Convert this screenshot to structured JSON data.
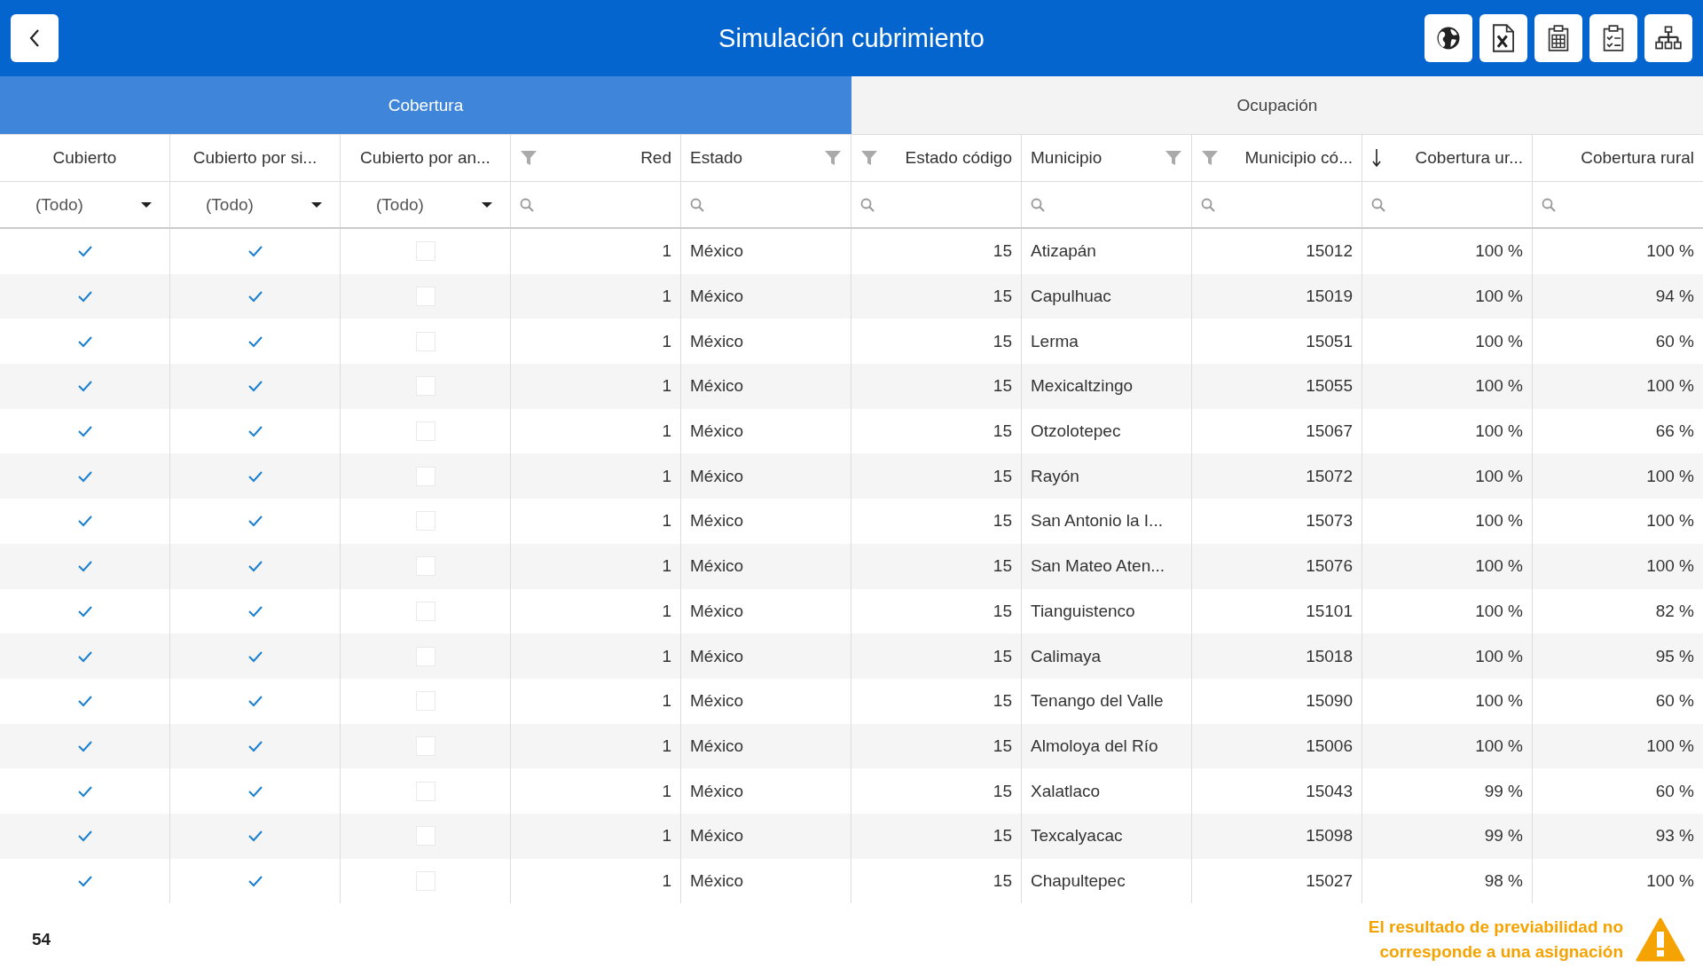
{
  "window": {
    "title": "Simulación cubrimiento"
  },
  "toolbar": [
    {
      "kind": "globe"
    },
    {
      "kind": "excel"
    },
    {
      "kind": "calendar"
    },
    {
      "kind": "checklist"
    },
    {
      "kind": "hierarchy"
    }
  ],
  "tabs": [
    {
      "label": "Cobertura",
      "selected": true
    },
    {
      "label": "Ocupación",
      "selected": false
    }
  ],
  "table": {
    "columns": [
      {
        "label": "Cubierto",
        "kind": "check",
        "filterable": false,
        "sorted_descending": false,
        "filter": "(Todo)"
      },
      {
        "label": "Cubierto por si...",
        "kind": "check",
        "filterable": false,
        "sorted_descending": false,
        "filter": "(Todo)"
      },
      {
        "label": "Cubierto por an...",
        "kind": "check",
        "filterable": false,
        "sorted_descending": false,
        "filter": "(Todo)"
      },
      {
        "label": "Red",
        "kind": "number",
        "filterable": true,
        "sorted_descending": false
      },
      {
        "label": "Estado",
        "kind": "text",
        "filterable": true,
        "sorted_descending": false
      },
      {
        "label": "Estado código",
        "kind": "number",
        "filterable": true,
        "sorted_descending": false
      },
      {
        "label": "Municipio",
        "kind": "text",
        "filterable": true,
        "sorted_descending": false
      },
      {
        "label": "Municipio có...",
        "kind": "number",
        "filterable": true,
        "sorted_descending": false
      },
      {
        "label": "Cobertura ur...",
        "kind": "number",
        "filterable": false,
        "sorted_descending": true
      },
      {
        "label": "Cobertura rural",
        "kind": "number",
        "filterable": false,
        "sorted_descending": false
      }
    ],
    "rows": [
      {
        "cells": [
          true,
          true,
          false,
          "1",
          "México",
          "15",
          "Atizapán",
          "15012",
          "100 %",
          "100 %"
        ]
      },
      {
        "cells": [
          true,
          true,
          false,
          "1",
          "México",
          "15",
          "Capulhuac",
          "15019",
          "100 %",
          "94 %"
        ]
      },
      {
        "cells": [
          true,
          true,
          false,
          "1",
          "México",
          "15",
          "Lerma",
          "15051",
          "100 %",
          "60 %"
        ]
      },
      {
        "cells": [
          true,
          true,
          false,
          "1",
          "México",
          "15",
          "Mexicaltzingo",
          "15055",
          "100 %",
          "100 %"
        ]
      },
      {
        "cells": [
          true,
          true,
          false,
          "1",
          "México",
          "15",
          "Otzolotepec",
          "15067",
          "100 %",
          "66 %"
        ]
      },
      {
        "cells": [
          true,
          true,
          false,
          "1",
          "México",
          "15",
          "Rayón",
          "15072",
          "100 %",
          "100 %"
        ]
      },
      {
        "cells": [
          true,
          true,
          false,
          "1",
          "México",
          "15",
          "San Antonio la I...",
          "15073",
          "100 %",
          "100 %"
        ]
      },
      {
        "cells": [
          true,
          true,
          false,
          "1",
          "México",
          "15",
          "San Mateo Aten...",
          "15076",
          "100 %",
          "100 %"
        ]
      },
      {
        "cells": [
          true,
          true,
          false,
          "1",
          "México",
          "15",
          "Tianguistenco",
          "15101",
          "100 %",
          "82 %"
        ]
      },
      {
        "cells": [
          true,
          true,
          false,
          "1",
          "México",
          "15",
          "Calimaya",
          "15018",
          "100 %",
          "95 %"
        ]
      },
      {
        "cells": [
          true,
          true,
          false,
          "1",
          "México",
          "15",
          "Tenango del Valle",
          "15090",
          "100 %",
          "60 %"
        ]
      },
      {
        "cells": [
          true,
          true,
          false,
          "1",
          "México",
          "15",
          "Almoloya del Río",
          "15006",
          "100 %",
          "100 %"
        ]
      },
      {
        "cells": [
          true,
          true,
          false,
          "1",
          "México",
          "15",
          "Xalatlaco",
          "15043",
          "99 %",
          "60 %"
        ]
      },
      {
        "cells": [
          true,
          true,
          false,
          "1",
          "México",
          "15",
          "Texcalyacac",
          "15098",
          "99 %",
          "93 %"
        ]
      },
      {
        "cells": [
          true,
          true,
          false,
          "1",
          "México",
          "15",
          "Chapultepec",
          "15027",
          "98 %",
          "100 %"
        ]
      }
    ]
  },
  "footer": {
    "count": "54",
    "warning": "El resultado de previabilidad no corresponde a una asignación"
  }
}
